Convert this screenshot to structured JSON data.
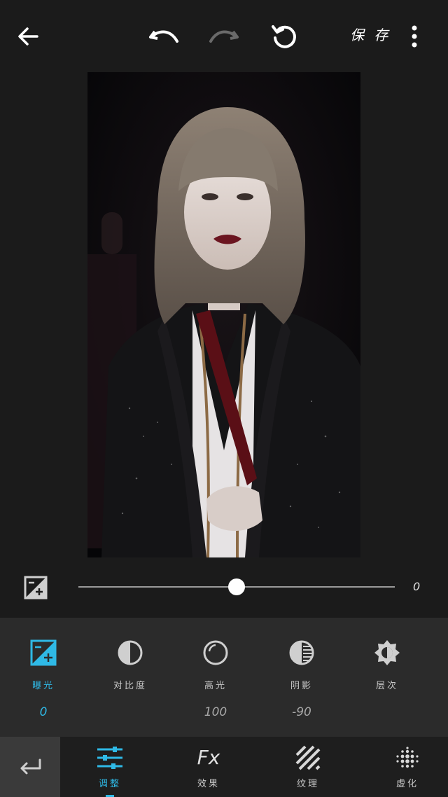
{
  "header": {
    "save_label": "保 存"
  },
  "slider": {
    "value_text": "0",
    "fraction": 0.5
  },
  "tools": [
    {
      "label": "曝光",
      "value": "0"
    },
    {
      "label": "对比度",
      "value": ""
    },
    {
      "label": "高光",
      "value": "100"
    },
    {
      "label": "阴影",
      "value": "-90"
    },
    {
      "label": "层次",
      "value": ""
    }
  ],
  "tabs": [
    {
      "label": "调整"
    },
    {
      "label": "效果",
      "icon_text": "Fx"
    },
    {
      "label": "纹理"
    },
    {
      "label": "虚化"
    }
  ],
  "colors": {
    "accent": "#2fb9e6",
    "panel": "#2b2b2b",
    "background": "#1b1b1b"
  }
}
